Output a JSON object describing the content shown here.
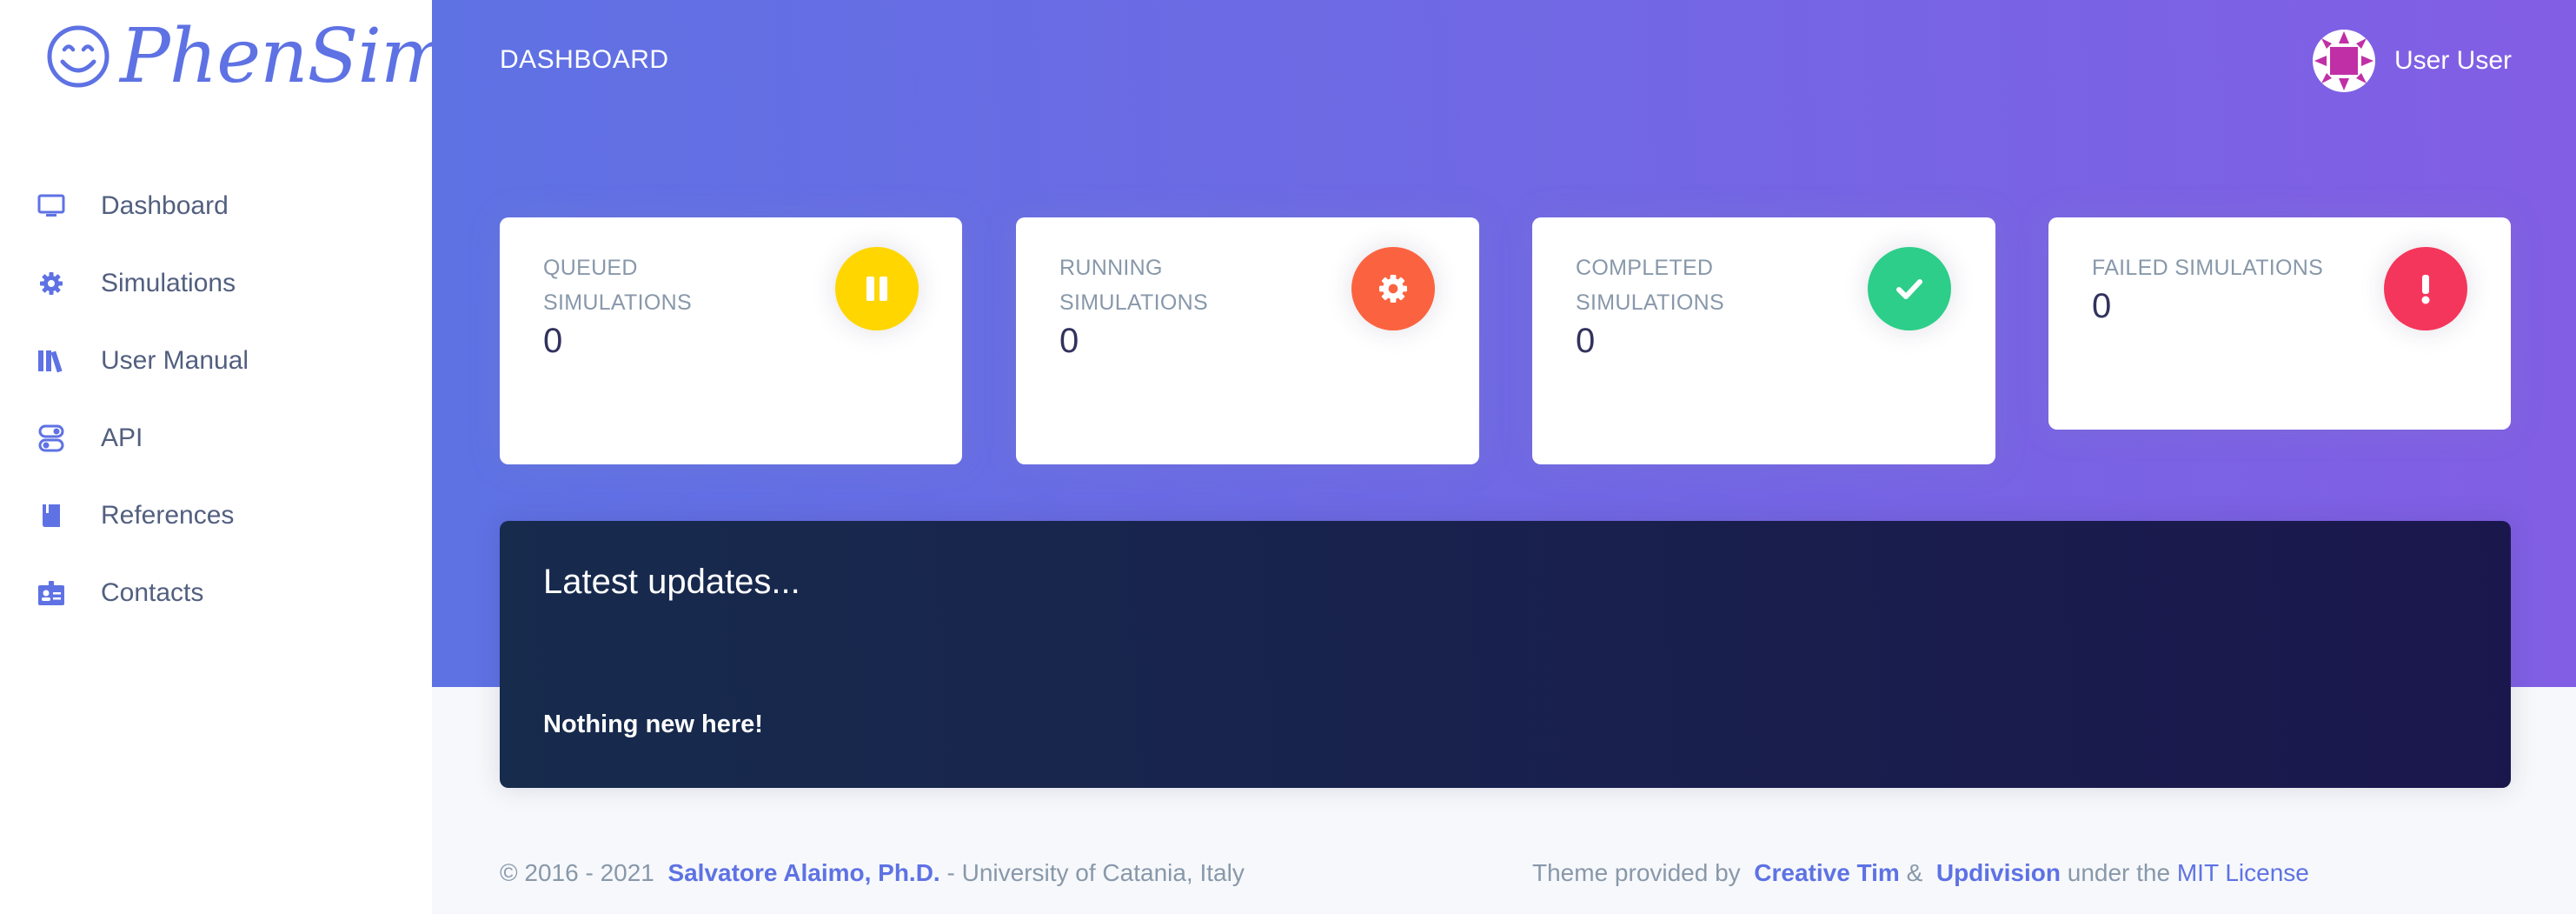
{
  "brand": {
    "name": "PhenSim",
    "icon": "smiley-icon"
  },
  "sidebar": {
    "items": [
      {
        "label": "Dashboard",
        "icon": "monitor-icon"
      },
      {
        "label": "Simulations",
        "icon": "gear-icon"
      },
      {
        "label": "User Manual",
        "icon": "library-icon"
      },
      {
        "label": "API",
        "icon": "toggle-icon"
      },
      {
        "label": "References",
        "icon": "book-icon"
      },
      {
        "label": "Contacts",
        "icon": "badge-icon"
      }
    ]
  },
  "header": {
    "title": "DASHBOARD"
  },
  "user": {
    "name": "User User"
  },
  "cards": [
    {
      "title_line1": "QUEUED",
      "title_line2": "SIMULATIONS",
      "value": "0",
      "icon": "pause-icon",
      "color": "#ffd600"
    },
    {
      "title_line1": "RUNNING",
      "title_line2": "SIMULATIONS",
      "value": "0",
      "icon": "gear-icon",
      "color": "#fb6340"
    },
    {
      "title_line1": "COMPLETED",
      "title_line2": "SIMULATIONS",
      "value": "0",
      "icon": "check-icon",
      "color": "#2dce89"
    },
    {
      "title_line1": "FAILED SIMULATIONS",
      "title_line2": "",
      "value": "0",
      "icon": "exclamation-icon",
      "color": "#f5365c"
    }
  ],
  "updates": {
    "title": "Latest updates...",
    "body": "Nothing new here!"
  },
  "footer": {
    "copyright": "© 2016 - 2021",
    "author": "Salvatore Alaimo, Ph.D.",
    "affiliation": "- University of Catania, Italy",
    "theme_prefix": "Theme provided by",
    "theme_author1": "Creative Tim",
    "amp": "&",
    "theme_author2": "Updivision",
    "license_prefix": "under the",
    "license": "MIT License"
  },
  "colors": {
    "primary": "#5e72e4",
    "gradient_end": "#825ee4",
    "dark": "#172b4d"
  }
}
